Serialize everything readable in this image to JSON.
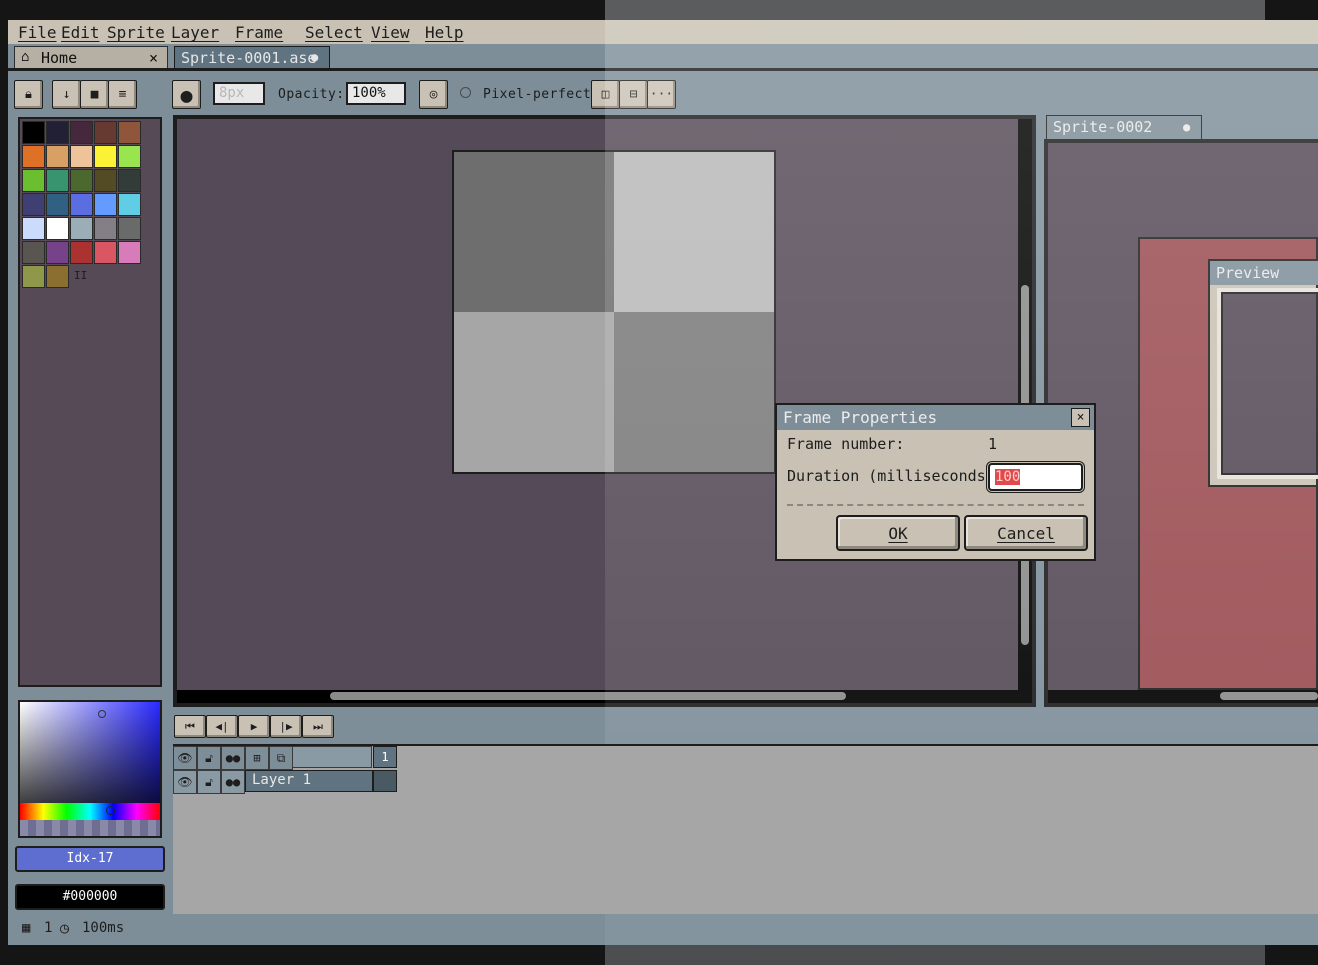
{
  "menubar": {
    "items": [
      "File",
      "Edit",
      "Sprite",
      "Layer",
      "Frame",
      "Select",
      "View",
      "Help"
    ]
  },
  "tabs": [
    {
      "label": "Home",
      "icon": "home-icon",
      "close": "×"
    },
    {
      "label": "Sprite-0001.ase",
      "modified": "●"
    }
  ],
  "toolbar": {
    "brush_size": "8px",
    "opacity_label": "Opacity:",
    "opacity_value": "100%",
    "pixel_perfect_label": "Pixel-perfect",
    "more_label": "···"
  },
  "palette": {
    "colors": [
      "#000000",
      "#222034",
      "#45283c",
      "#663931",
      "#8f563b",
      "#df7126",
      "#d9a066",
      "#eec39a",
      "#fbf236",
      "#99e550",
      "#6abe30",
      "#37946e",
      "#4b692f",
      "#524b24",
      "#323c39",
      "#3f3f74",
      "#306082",
      "#5b6ee1",
      "#639bff",
      "#5fcde4",
      "#cbdbfc",
      "#ffffff",
      "#9badb7",
      "#847e87",
      "#696a6a",
      "#595652",
      "#76428a",
      "#ac3232",
      "#d95763",
      "#d77bba",
      "#8f974a",
      "#8a6f30"
    ],
    "page_marker": "II"
  },
  "color_picker": {
    "index_label": "Idx-17",
    "hex_value": "#000000"
  },
  "canvas": {
    "quadrants": [
      "#6e6e6e",
      "#b8b8b8",
      "#a6a6a6",
      "#7a7a7a"
    ]
  },
  "sprite2": {
    "tab_label": "Sprite-0002",
    "modified": "●",
    "preview_title": "Preview"
  },
  "timeline": {
    "frame_number_header": "1",
    "layer_name": "Layer 1"
  },
  "dialog": {
    "title": "Frame Properties",
    "close": "×",
    "frame_number_label": "Frame number:",
    "frame_number_value": "1",
    "duration_label": "Duration (milliseconds):",
    "duration_value": "100",
    "ok_label": "OK",
    "cancel_label": "Cancel"
  },
  "statusbar": {
    "frame": "1",
    "duration": "100ms"
  }
}
